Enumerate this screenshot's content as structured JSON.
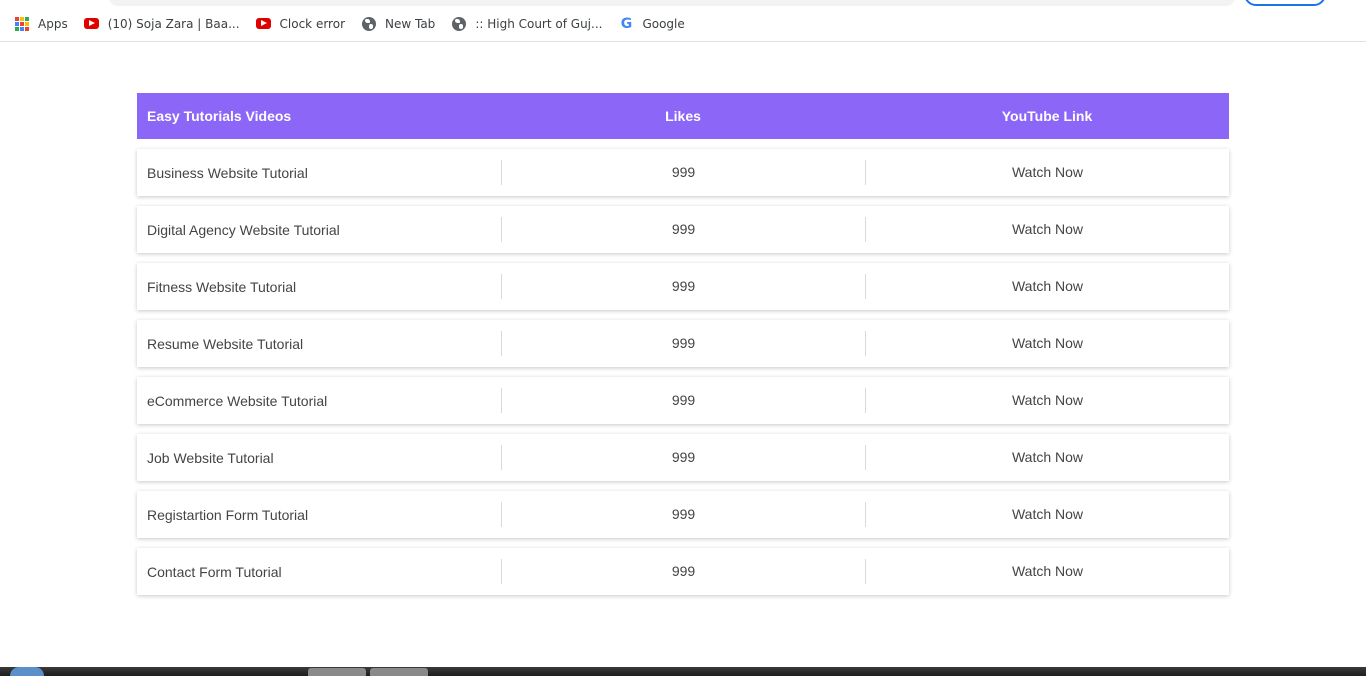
{
  "bookmarks": [
    {
      "label": "Apps",
      "icon": "apps-grid-icon"
    },
    {
      "label": "(10) Soja Zara | Baa...",
      "icon": "youtube-icon"
    },
    {
      "label": "Clock error",
      "icon": "youtube-icon"
    },
    {
      "label": "New Tab",
      "icon": "globe-icon"
    },
    {
      "label": ":: High Court of Guj...",
      "icon": "globe-icon"
    },
    {
      "label": "Google",
      "icon": "google-icon"
    }
  ],
  "table": {
    "headers": [
      "Easy Tutorials Videos",
      "Likes",
      "YouTube Link"
    ],
    "rows": [
      {
        "title": "Business Website Tutorial",
        "likes": "999",
        "link": "Watch Now"
      },
      {
        "title": "Digital Agency Website Tutorial",
        "likes": "999",
        "link": "Watch Now"
      },
      {
        "title": "Fitness Website Tutorial",
        "likes": "999",
        "link": "Watch Now"
      },
      {
        "title": "Resume Website Tutorial",
        "likes": "999",
        "link": "Watch Now"
      },
      {
        "title": "eCommerce Website Tutorial",
        "likes": "999",
        "link": "Watch Now"
      },
      {
        "title": "Job Website Tutorial",
        "likes": "999",
        "link": "Watch Now"
      },
      {
        "title": "Registartion Form Tutorial",
        "likes": "999",
        "link": "Watch Now"
      },
      {
        "title": "Contact Form Tutorial",
        "likes": "999",
        "link": "Watch Now"
      }
    ]
  },
  "colors": {
    "header_bg": "#8b66f7",
    "header_text": "#ffffff",
    "row_text": "#444444",
    "apps_grid": [
      "#ea4335",
      "#fbbc05",
      "#34a853",
      "#4285f4",
      "#ea4335",
      "#fbbc05",
      "#34a853",
      "#4285f4",
      "#ea4335"
    ]
  }
}
